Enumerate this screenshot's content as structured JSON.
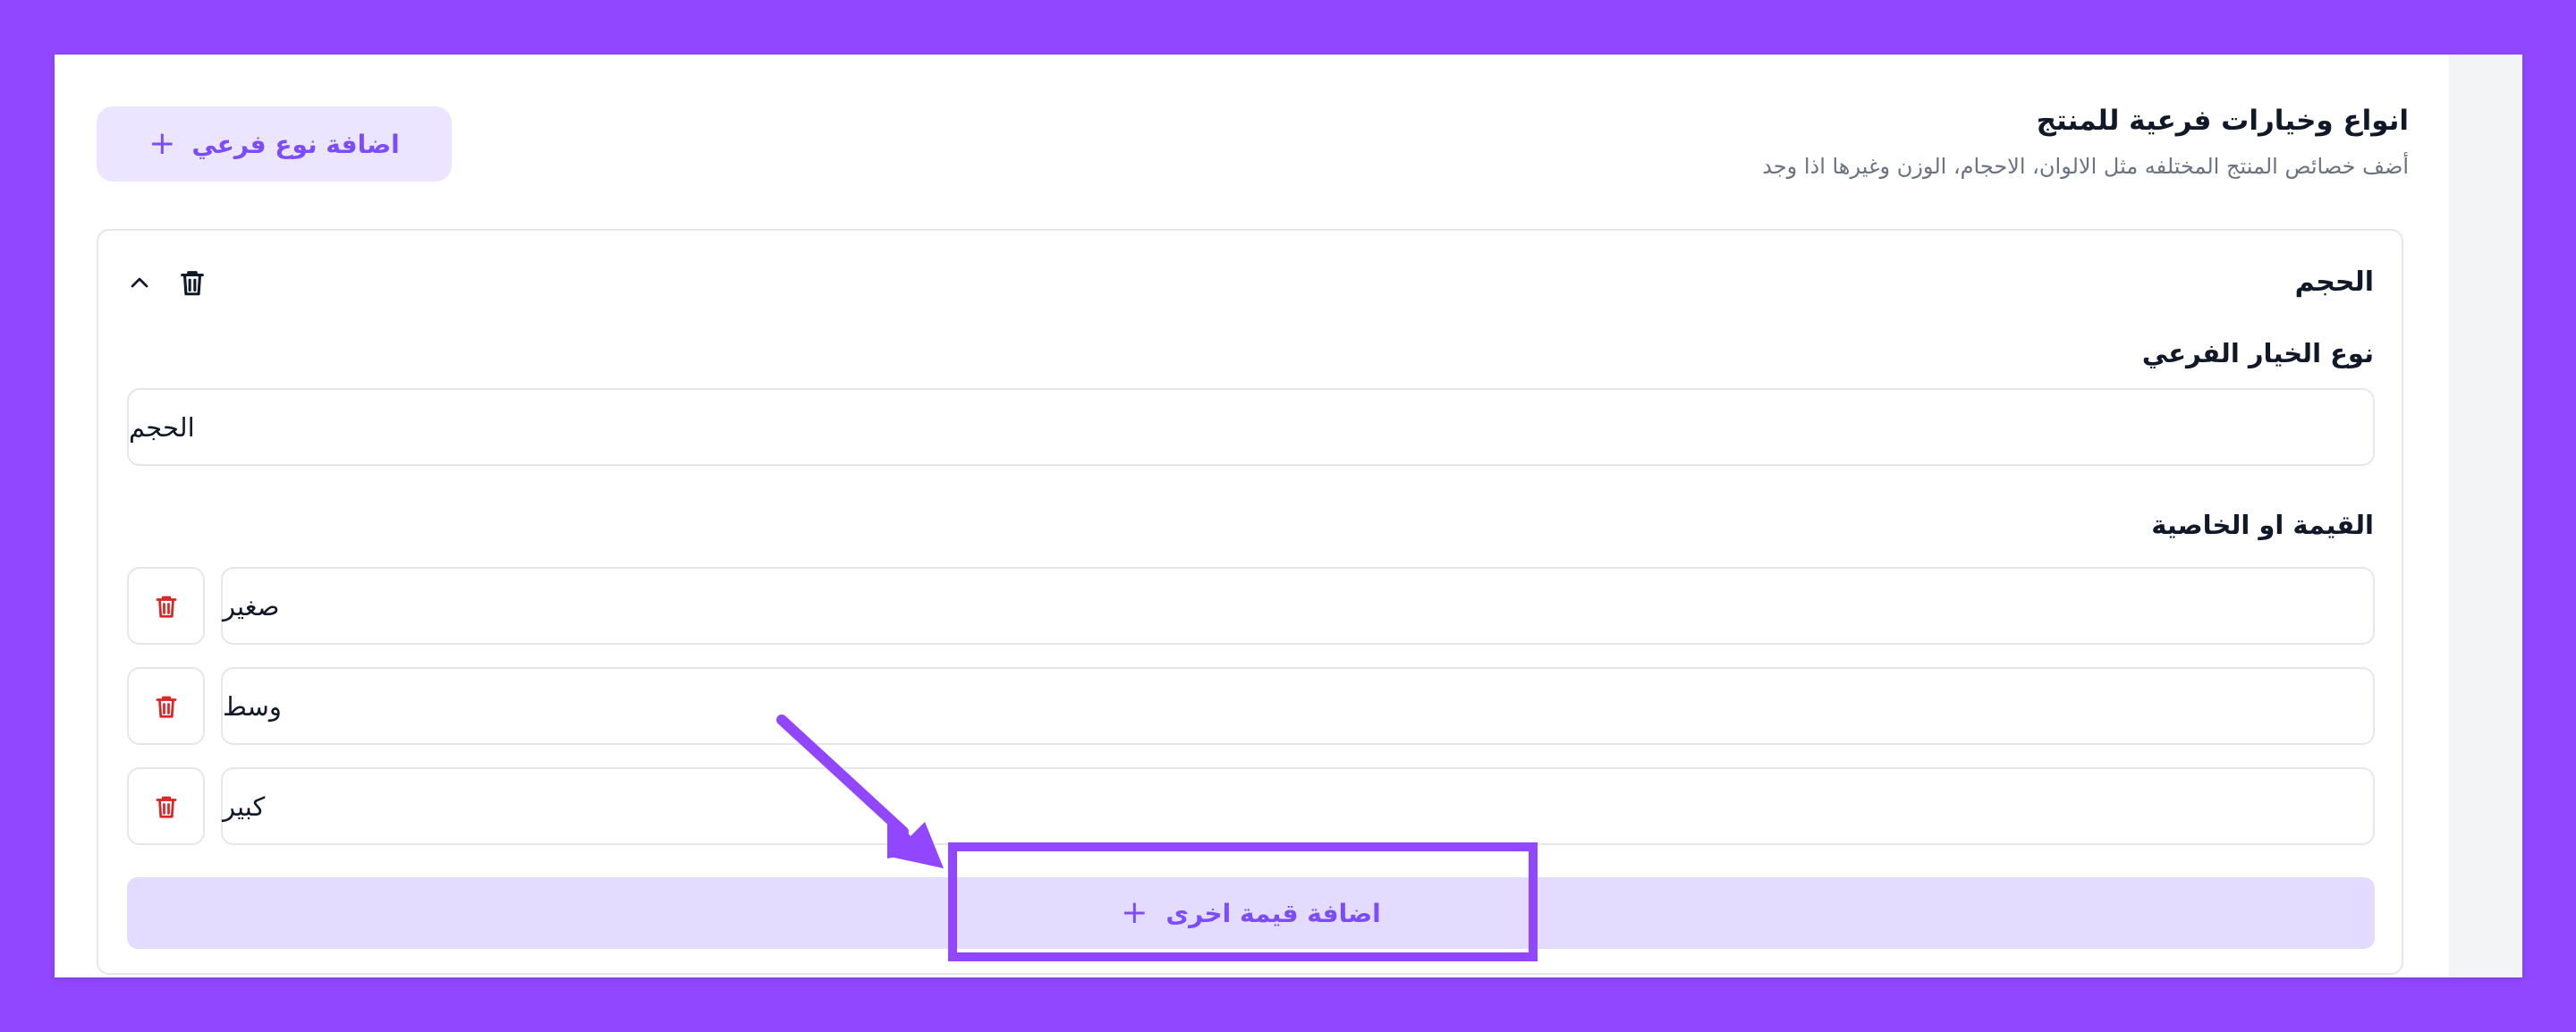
{
  "section": {
    "title": "انواع وخيارات فرعية للمنتج",
    "subtitle": "أضف خصائص المنتج المختلفه مثل الالوان، الاحجام، الوزن وغيرها اذا وجد",
    "add_variant_label": "اضافة نوع فرعي",
    "plus": "+"
  },
  "variant": {
    "title": "الحجم",
    "type_label": "نوع الخيار الفرعي",
    "type_value": "الحجم",
    "values_label": "القيمة او الخاصية",
    "values": [
      "صغير",
      "وسط",
      "كبير"
    ],
    "add_value_label": "اضافة قيمة اخرى",
    "plus": "+"
  },
  "colors": {
    "accent": "#9047ff",
    "button_bg": "#ebe5ff",
    "delete_red": "#dc2626"
  },
  "icons": {
    "collapse": "chevron-up-icon",
    "delete": "trash-icon",
    "add": "plus-icon"
  }
}
